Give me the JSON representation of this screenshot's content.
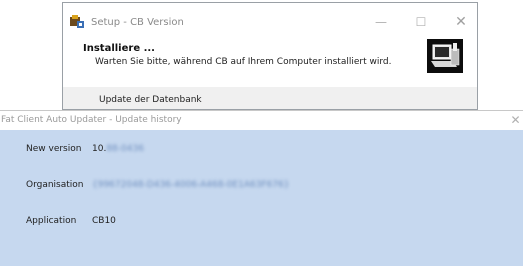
{
  "setup_window": {
    "title": "Setup - CB Version",
    "heading": "Installiere ...",
    "message": "Warten Sie bitte, während CB auf Ihrem Computer installiert wird.",
    "status": "Update der Datenbank",
    "controls": {
      "minimize": "—",
      "maximize": "☐",
      "close": "✕"
    }
  },
  "updater_window": {
    "title": "Fat Client Auto Updater - Update history",
    "close": "✕",
    "fields": [
      {
        "label": "New version",
        "prefix": "10.",
        "value_redacted": "88-0436"
      },
      {
        "label": "Organisation",
        "value_redacted": "{99672048-D436-4006-A468-0E1A63F676}"
      },
      {
        "label": "Application",
        "value": "CB10"
      }
    ]
  },
  "colors": {
    "updater_background": "#c6d8ef",
    "redacted_text": "#6f8fbf"
  }
}
